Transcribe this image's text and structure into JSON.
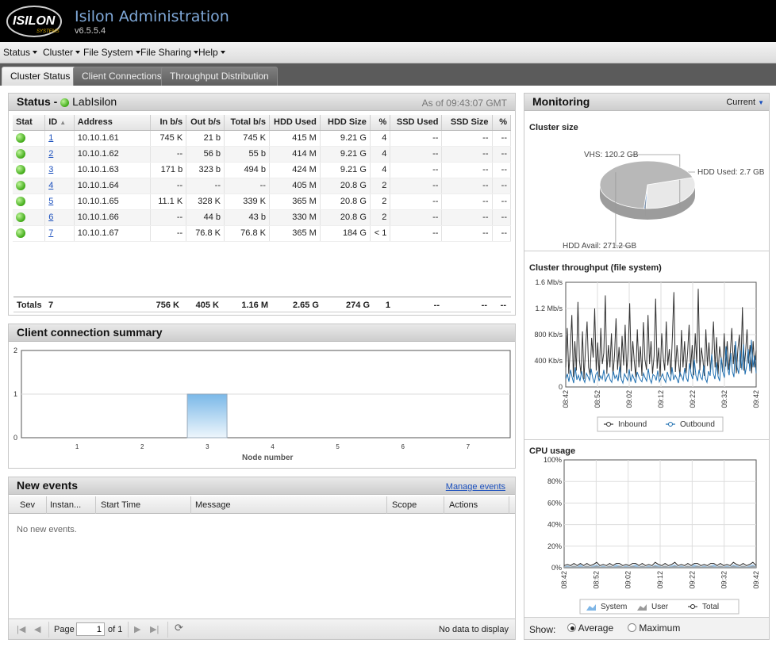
{
  "header": {
    "logo_text": "ISILON",
    "logo_sub": "SYSTEMS",
    "title": "Isilon Administration",
    "version": "v6.5.5.4"
  },
  "menu": [
    {
      "label": "Status"
    },
    {
      "label": "Cluster"
    },
    {
      "label": "File System"
    },
    {
      "label": "File Sharing"
    },
    {
      "label": "Help"
    }
  ],
  "tabs": [
    {
      "label": "Cluster Status",
      "active": true
    },
    {
      "label": "Client Connections",
      "active": false
    },
    {
      "label": "Throughput Distribution",
      "active": false
    }
  ],
  "status_panel": {
    "title_prefix": "Status -",
    "cluster_name": "LabIsilon",
    "as_of": "As of 09:43:07 GMT",
    "columns": [
      "Stat",
      "ID",
      "Address",
      "In b/s",
      "Out b/s",
      "Total b/s",
      "HDD Used",
      "HDD Size",
      "%",
      "SSD Used",
      "SSD Size",
      "%"
    ],
    "rows": [
      {
        "id": "1",
        "address": "10.10.1.61",
        "in": "745 K",
        "out": "21 b",
        "total": "745 K",
        "hdd_used": "415 M",
        "hdd_size": "9.21 G",
        "pct": "4",
        "ssd_used": "--",
        "ssd_size": "--",
        "ssd_pct": "--"
      },
      {
        "id": "2",
        "address": "10.10.1.62",
        "in": "--",
        "out": "56 b",
        "total": "55 b",
        "hdd_used": "414 M",
        "hdd_size": "9.21 G",
        "pct": "4",
        "ssd_used": "--",
        "ssd_size": "--",
        "ssd_pct": "--"
      },
      {
        "id": "3",
        "address": "10.10.1.63",
        "in": "171 b",
        "out": "323 b",
        "total": "494 b",
        "hdd_used": "424 M",
        "hdd_size": "9.21 G",
        "pct": "4",
        "ssd_used": "--",
        "ssd_size": "--",
        "ssd_pct": "--"
      },
      {
        "id": "4",
        "address": "10.10.1.64",
        "in": "--",
        "out": "--",
        "total": "--",
        "hdd_used": "405 M",
        "hdd_size": "20.8 G",
        "pct": "2",
        "ssd_used": "--",
        "ssd_size": "--",
        "ssd_pct": "--"
      },
      {
        "id": "5",
        "address": "10.10.1.65",
        "in": "11.1 K",
        "out": "328 K",
        "total": "339 K",
        "hdd_used": "365 M",
        "hdd_size": "20.8 G",
        "pct": "2",
        "ssd_used": "--",
        "ssd_size": "--",
        "ssd_pct": "--"
      },
      {
        "id": "6",
        "address": "10.10.1.66",
        "in": "--",
        "out": "44 b",
        "total": "43 b",
        "hdd_used": "330 M",
        "hdd_size": "20.8 G",
        "pct": "2",
        "ssd_used": "--",
        "ssd_size": "--",
        "ssd_pct": "--"
      },
      {
        "id": "7",
        "address": "10.10.1.67",
        "in": "--",
        "out": "76.8 K",
        "total": "76.8 K",
        "hdd_used": "365 M",
        "hdd_size": "184 G",
        "pct": "< 1",
        "ssd_used": "--",
        "ssd_size": "--",
        "ssd_pct": "--"
      }
    ],
    "totals": {
      "label": "Totals",
      "count": "7",
      "in": "756 K",
      "out": "405 K",
      "total": "1.16 M",
      "hdd_used": "2.65 G",
      "hdd_size": "274 G",
      "pct": "1",
      "ssd_used": "--",
      "ssd_size": "--",
      "ssd_pct": "--"
    }
  },
  "client_summary": {
    "title": "Client connection summary",
    "xlabel": "Node number"
  },
  "events": {
    "title": "New events",
    "manage_link": "Manage events",
    "columns": [
      "Sev",
      "Instan...",
      "Start Time",
      "Message",
      "Scope",
      "Actions"
    ],
    "empty_text": "No new events.",
    "pager": {
      "page_label": "Page",
      "page_value": "1",
      "of_label": "of 1",
      "no_data": "No data to display"
    }
  },
  "monitoring": {
    "title": "Monitoring",
    "mode": "Current",
    "cluster_size_title": "Cluster size",
    "throughput_title": "Cluster throughput (file system)",
    "cpu_title": "CPU usage",
    "show_label": "Show:",
    "show_options": [
      {
        "label": "Average",
        "selected": true
      },
      {
        "label": "Maximum",
        "selected": false
      }
    ]
  },
  "chart_data": [
    {
      "type": "bar",
      "title": "",
      "xlabel": "Node number",
      "ylabel": "",
      "categories": [
        "1",
        "2",
        "3",
        "4",
        "5",
        "6",
        "7"
      ],
      "values": [
        0,
        0,
        1,
        0,
        0,
        0,
        0
      ],
      "ylim": [
        0,
        2
      ],
      "yticks": [
        "0",
        "1",
        "2"
      ],
      "colors": {
        "bar": "#8fc6ee"
      }
    },
    {
      "type": "pie",
      "title": "Cluster size",
      "slices": [
        {
          "label": "VHS: 120.2 GB",
          "value": 120.2
        },
        {
          "label": "HDD Used: 2.7 GB",
          "value": 2.7
        },
        {
          "label": "HDD Avail: 271.2 GB",
          "value": 271.2
        }
      ],
      "colors": [
        "#e8e8e8",
        "#5a8fd0",
        "#b8b8b8"
      ]
    },
    {
      "type": "line",
      "title": "Cluster throughput (file system)",
      "x_ticks": [
        "08:42",
        "08:52",
        "09:02",
        "09:12",
        "09:22",
        "09:32",
        "09:42"
      ],
      "y_ticks": [
        "0",
        "400 Kb/s",
        "800 Kb/s",
        "1.2 Mb/s",
        "1.6 Mb/s"
      ],
      "ylim_kbps": [
        0,
        1600
      ],
      "series": [
        {
          "name": "Inbound",
          "color": "#333333",
          "values": [
            300,
            900,
            200,
            600,
            1100,
            150,
            700,
            250,
            1300,
            400,
            200,
            850,
            120,
            600,
            1000,
            300,
            180,
            750,
            450,
            1200,
            250,
            680,
            150,
            900,
            350,
            520,
            1400,
            200,
            640,
            300,
            820,
            180,
            470,
            1050,
            260,
            610,
            140,
            780,
            330,
            950,
            210,
            560,
            1280,
            240,
            700,
            390,
            150,
            880,
            300,
            620,
            170,
            990,
            420,
            260,
            1100,
            350,
            700,
            200,
            480,
            1350,
            280,
            600,
            160,
            820,
            450,
            250,
            1000,
            330,
            580,
            190,
            760,
            1450,
            230,
            640,
            380,
            160,
            870,
            300,
            700,
            210,
            530,
            950,
            270,
            640,
            180,
            820,
            360,
            1500,
            250,
            600,
            420,
            170,
            880,
            320,
            680,
            230,
            540,
            1000,
            300,
            760,
            190,
            620,
            450,
            230,
            820,
            310,
            700,
            260,
            520,
            900,
            350,
            640,
            210,
            580,
            800,
            290,
            1220,
            250,
            520,
            880,
            360,
            640,
            210,
            700,
            300,
            560
          ]
        },
        {
          "name": "Outbound",
          "color": "#1f6fb0",
          "values": [
            120,
            200,
            80,
            260,
            150,
            60,
            300,
            110,
            180,
            90,
            240,
            130,
            70,
            210,
            160,
            100,
            280,
            140,
            60,
            190,
            230,
            90,
            170,
            120,
            260,
            80,
            150,
            200,
            110,
            70,
            240,
            130,
            180,
            90,
            310,
            120,
            60,
            200,
            150,
            100,
            270,
            80,
            190,
            130,
            60,
            230,
            160,
            110,
            80,
            210,
            140,
            90,
            280,
            120,
            60,
            190,
            170,
            100,
            250,
            80,
            140,
            200,
            120,
            70,
            230,
            150,
            90,
            300,
            110,
            180,
            130,
            60,
            220,
            160,
            100,
            290,
            140,
            80,
            360,
            200,
            120,
            420,
            180,
            90,
            260,
            150,
            110,
            330,
            130,
            70,
            240,
            170,
            500,
            210,
            120,
            380,
            160,
            90,
            450,
            230,
            140,
            620,
            280,
            180,
            520,
            240,
            150,
            700,
            300,
            200,
            560,
            260,
            650,
            190,
            320,
            580,
            240,
            720,
            300,
            480,
            210
          ]
        }
      ]
    },
    {
      "type": "area",
      "title": "CPU usage",
      "x_ticks": [
        "08:42",
        "08:52",
        "09:02",
        "09:12",
        "09:22",
        "09:32",
        "09:42"
      ],
      "y_ticks": [
        "0%",
        "20%",
        "40%",
        "60%",
        "80%",
        "100%"
      ],
      "ylim": [
        0,
        100
      ],
      "series": [
        {
          "name": "System",
          "color": "#7fb6e6",
          "values": [
            1,
            2,
            1,
            2,
            1,
            3,
            1,
            2,
            1,
            2,
            3,
            1,
            2,
            1,
            2,
            1,
            3,
            2,
            1,
            2,
            1,
            2,
            3,
            1,
            2,
            1,
            2,
            1,
            3,
            2,
            1,
            2,
            1,
            2,
            3,
            1,
            2,
            1,
            2,
            1,
            3,
            2,
            1,
            2,
            1,
            2,
            3,
            1,
            2,
            1,
            2,
            1,
            3,
            2,
            1,
            2,
            1,
            2,
            3,
            1
          ]
        },
        {
          "name": "User",
          "color": "#9a9a9a",
          "values": [
            1,
            1,
            1,
            2,
            1,
            1,
            1,
            2,
            1,
            1,
            2,
            1,
            1,
            1,
            2,
            1,
            1,
            2,
            1,
            1,
            1,
            2,
            1,
            1,
            2,
            1,
            1,
            1,
            2,
            1,
            1,
            2,
            1,
            1,
            2,
            1,
            1,
            1,
            2,
            1,
            1,
            2,
            1,
            1,
            1,
            2,
            1,
            1,
            2,
            1,
            1,
            1,
            2,
            1,
            1,
            2,
            1,
            1,
            2,
            1
          ]
        },
        {
          "name": "Total",
          "color": "#222222",
          "values": [
            2,
            3,
            2,
            4,
            2,
            4,
            2,
            4,
            2,
            3,
            5,
            2,
            3,
            2,
            4,
            2,
            4,
            4,
            2,
            3,
            2,
            4,
            4,
            2,
            4,
            2,
            3,
            2,
            5,
            3,
            2,
            4,
            2,
            3,
            5,
            2,
            3,
            2,
            4,
            2,
            4,
            4,
            2,
            3,
            2,
            4,
            4,
            2,
            4,
            2,
            3,
            2,
            5,
            3,
            2,
            4,
            2,
            3,
            5,
            2
          ]
        }
      ]
    }
  ]
}
